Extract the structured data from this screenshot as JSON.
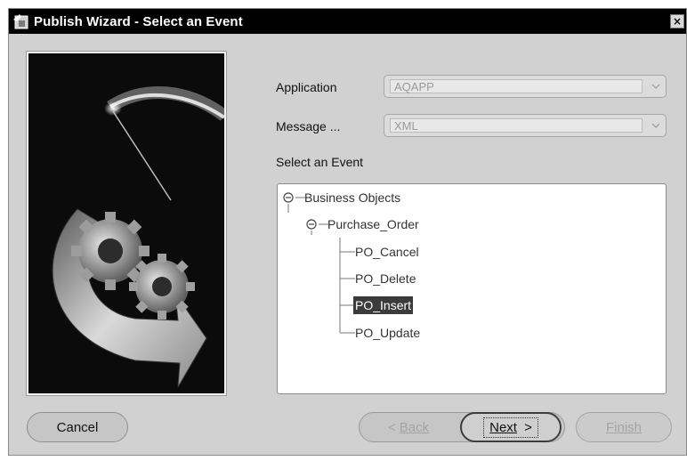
{
  "window": {
    "title": "Publish Wizard - Select an Event",
    "close_glyph": "×",
    "app_icon": "wizard-icon"
  },
  "form": {
    "application_label": "Application",
    "application_value": "AQAPP",
    "message_label": "Message ...",
    "message_value": "XML",
    "select_event_label": "Select an Event"
  },
  "tree": {
    "root": "Business Objects",
    "child": "Purchase_Order",
    "leaves": [
      "PO_Cancel",
      "PO_Delete",
      "PO_Insert",
      "PO_Update"
    ],
    "selected": "PO_Insert"
  },
  "buttons": {
    "cancel": "Cancel",
    "back": "Back",
    "next": "Next",
    "finish": "Finish",
    "back_glyph": "<",
    "next_glyph": ">"
  },
  "colors": {
    "titlebar": "#000000",
    "dialog": "#d1d1d1",
    "selection": "#3b3b3b"
  }
}
